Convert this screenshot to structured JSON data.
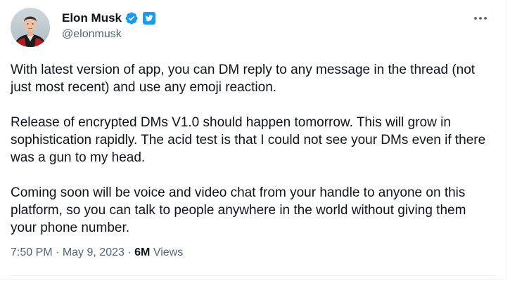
{
  "author": {
    "display_name": "Elon Musk",
    "handle": "@elonmusk",
    "verified": true,
    "badge_color": "#1d9bf0"
  },
  "icons": {
    "verified": "verified-badge-icon",
    "affiliation": "twitter-affiliation-icon",
    "more": "more-icon"
  },
  "tweet": {
    "paragraphs": [
      "With latest version of app, you can DM reply to any message in the thread (not just most recent) and use any emoji reaction.",
      "Release of encrypted DMs V1.0 should happen tomorrow. This will grow in sophistication rapidly. The acid test is that I could not see your DMs even if there was a gun to my head.",
      "Coming soon will be voice and video chat from your handle to anyone on this platform, so you can talk to people anywhere in the world without giving them your phone number."
    ]
  },
  "meta": {
    "time": "7:50 PM",
    "separator": "·",
    "date": "May 9, 2023",
    "views_count": "6M",
    "views_label": "Views"
  }
}
